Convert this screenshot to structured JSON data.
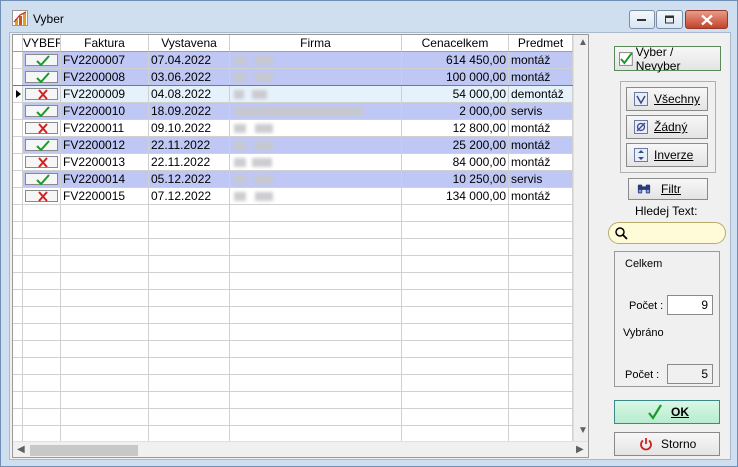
{
  "window": {
    "title": "Vyber"
  },
  "grid": {
    "columns": [
      "VYBER",
      "Faktura",
      "Vystavena",
      "Firma",
      "Cenacelkem",
      "Predmet"
    ],
    "rows": [
      {
        "selected": true,
        "faktura": "FV2200007",
        "vystavena": "07.04.2022",
        "cena": "614 450,00",
        "predmet": "montáž"
      },
      {
        "selected": true,
        "faktura": "FV2200008",
        "vystavena": "03.06.2022",
        "cena": "100 000,00",
        "predmet": "montáž"
      },
      {
        "selected": false,
        "faktura": "FV2200009",
        "vystavena": "04.08.2022",
        "cena": "54 000,00",
        "predmet": "demontáž"
      },
      {
        "selected": true,
        "faktura": "FV2200010",
        "vystavena": "18.09.2022",
        "cena": "2 000,00",
        "predmet": "servis"
      },
      {
        "selected": false,
        "faktura": "FV2200011",
        "vystavena": "09.10.2022",
        "cena": "12 800,00",
        "predmet": "montáž"
      },
      {
        "selected": true,
        "faktura": "FV2200012",
        "vystavena": "22.11.2022",
        "cena": "25 200,00",
        "predmet": "montáž"
      },
      {
        "selected": false,
        "faktura": "FV2200013",
        "vystavena": "22.11.2022",
        "cena": "84 000,00",
        "predmet": "montáž"
      },
      {
        "selected": true,
        "faktura": "FV2200014",
        "vystavena": "05.12.2022",
        "cena": "10 250,00",
        "predmet": "servis"
      },
      {
        "selected": false,
        "faktura": "FV2200015",
        "vystavena": "07.12.2022",
        "cena": "134 000,00",
        "predmet": "montáž"
      }
    ]
  },
  "buttons": {
    "vyber_nevyber": "Vyber / Nevyber",
    "vsechny": "Všechny",
    "zadny": "Žádný",
    "inverze": "Inverze",
    "filtr": "Filtr",
    "ok": "OK",
    "storno": "Storno"
  },
  "search": {
    "label": "Hledej Text:",
    "value": ""
  },
  "summary": {
    "celkem_label": "Celkem",
    "pocet_label": "Počet :",
    "pocet_celkem": "9",
    "vybrano_label": "Vybráno",
    "pocet_vybrano": "5"
  },
  "colors": {
    "selected_row": "#bfc7f5",
    "check_green": "#1a9a2a",
    "cross_red": "#d02020"
  }
}
